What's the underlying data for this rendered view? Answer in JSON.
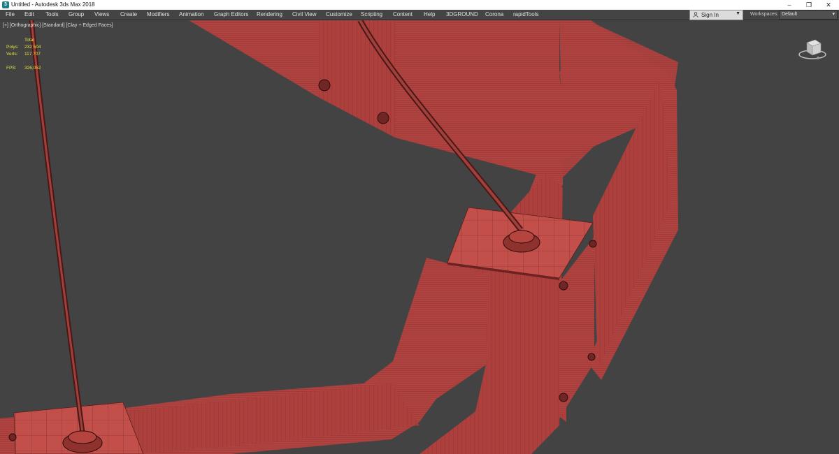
{
  "window": {
    "title": "Untitled - Autodesk 3ds Max 2018",
    "controls": [
      "–",
      "❐",
      "✕"
    ]
  },
  "menu": {
    "items": [
      "File",
      "Edit",
      "Tools",
      "Group",
      "Views",
      "Create",
      "Modifiers",
      "Animation",
      "Graph Editors",
      "Rendering",
      "Civil View",
      "Customize",
      "Scripting",
      "Content",
      "Help",
      "3DGROUND",
      "Corona",
      "rapidTools"
    ]
  },
  "account": {
    "sign_in_label": "Sign In",
    "workspaces_label": "Workspaces:",
    "workspace_value": "Default"
  },
  "viewport": {
    "label": "[+] [Orthographic] [Standard] [Clay + Edged Faces]",
    "stats": {
      "header": "Total",
      "polys_label": "Polys:",
      "polys_value": "232 504",
      "verts_label": "Verts:",
      "verts_value": "117 707",
      "fps_label": "FPS:",
      "fps_value": "326,052"
    }
  },
  "colors": {
    "model": "#b5443f",
    "model_dark": "#8f312d",
    "background": "#434343",
    "stats_text": "#e3e33a"
  },
  "icons": {
    "app": "3ds-max-logo-icon",
    "user": "user-icon",
    "viewcube": "viewcube-icon"
  }
}
